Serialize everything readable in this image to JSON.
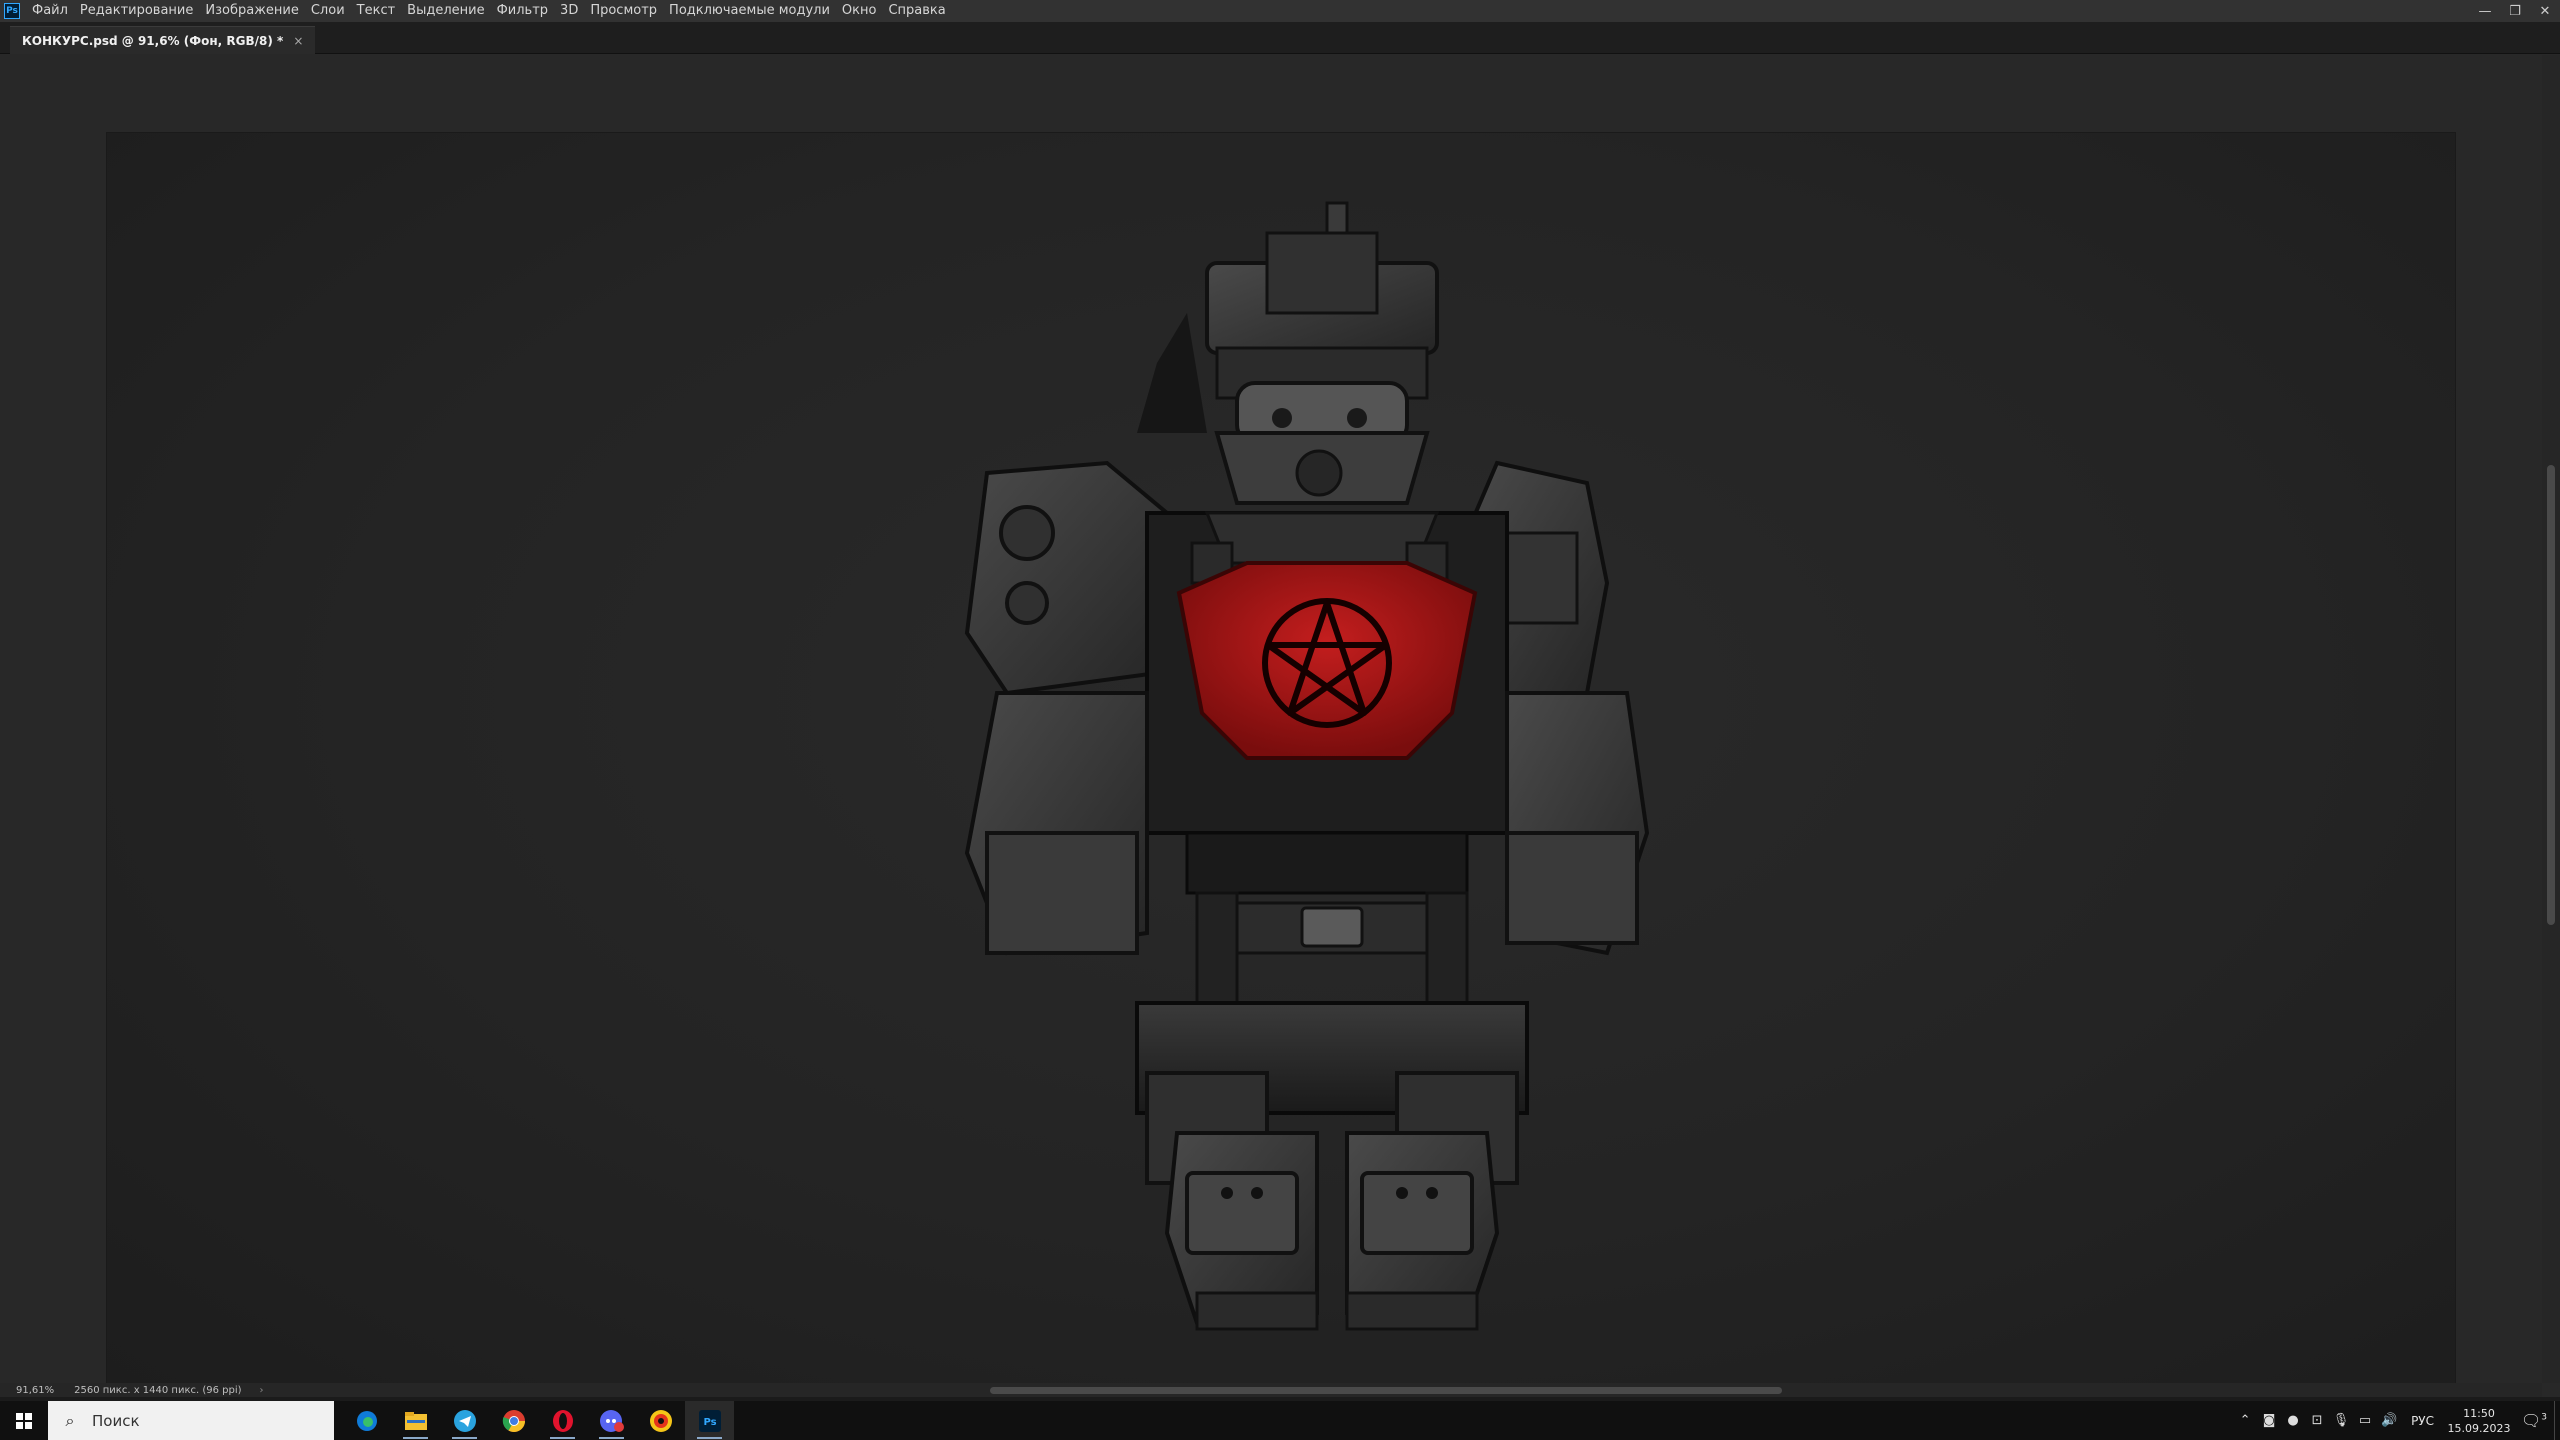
{
  "app": {
    "logo_text": "Ps",
    "menu": [
      "Файл",
      "Редактирование",
      "Изображение",
      "Слои",
      "Текст",
      "Выделение",
      "Фильтр",
      "3D",
      "Просмотр",
      "Подключаемые модули",
      "Окно",
      "Справка"
    ],
    "window_controls": {
      "minimize": "—",
      "restore": "❐",
      "close": "✕"
    }
  },
  "document_tab": {
    "title": "КОНКУРС.psd @ 91,6% (Фон, RGB/8) *",
    "close": "×"
  },
  "status": {
    "zoom": "91,61%",
    "doc_size": "2560 пикс. x 1440 пикс. (96 ppi)",
    "arrow": "›"
  },
  "taskbar": {
    "search_placeholder": "Поиск",
    "apps": [
      "edge-icon",
      "file-explorer-icon",
      "telegram-icon",
      "chrome-icon",
      "opera-icon",
      "discord-icon",
      "yandex-music-icon",
      "photoshop-icon"
    ],
    "photoshop_label": "Ps",
    "language": "РУС",
    "time": "11:50",
    "date": "15.09.2023",
    "notification_count": "3"
  },
  "colors": {
    "menubar": "#323232",
    "canvas_bg": "#282828",
    "chest_plate": "#b01818",
    "armor": "#3a3a3a",
    "accent": "#31a8ff"
  }
}
